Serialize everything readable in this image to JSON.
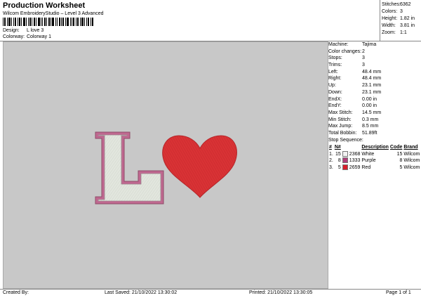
{
  "header": {
    "title": "Production Worksheet",
    "subtitle": "Wilcom EmbroideryStudio – Level 3 Advanced",
    "design_label": "Design:",
    "design_value": "L love 3",
    "colorway_label": "Colorway:",
    "colorway_value": "Colorway 1"
  },
  "stats": [
    {
      "label": "Stitches:",
      "value": "6362"
    },
    {
      "label": "Colors:",
      "value": "3"
    },
    {
      "label": "Height:",
      "value": "1.82 in"
    },
    {
      "label": "Width:",
      "value": "3.81 in"
    },
    {
      "label": "Zoom:",
      "value": "1:1"
    }
  ],
  "info": [
    {
      "label": "Machine:",
      "value": "Tajima"
    },
    {
      "label": "Color changes:",
      "value": "2"
    },
    {
      "label": "Stops:",
      "value": "3"
    },
    {
      "label": "Trims:",
      "value": "3"
    },
    {
      "label": "Left:",
      "value": "48.4 mm"
    },
    {
      "label": "Right:",
      "value": "48.4 mm"
    },
    {
      "label": "Up:",
      "value": "23.1 mm"
    },
    {
      "label": "Down:",
      "value": "23.1 mm"
    },
    {
      "label": "EndX:",
      "value": "0.00 in"
    },
    {
      "label": "EndY:",
      "value": "0.00 in"
    },
    {
      "label": "Max Stitch:",
      "value": "14.5 mm"
    },
    {
      "label": "Min Stitch:",
      "value": "0.3 mm"
    },
    {
      "label": "Max Jump:",
      "value": "8.5 mm"
    },
    {
      "label": "Total Bobbin:",
      "value": "51.89ft"
    }
  ],
  "sequence": {
    "title": "Stop Sequence:",
    "headers": [
      "#",
      "N#",
      "",
      "Description",
      "Code",
      "Brand"
    ],
    "rows": [
      {
        "idx": "1.",
        "needle": "15",
        "swatch": "#f2f2f2",
        "num": "2368",
        "desc": "White",
        "code": "15",
        "brand": "Wilcom"
      },
      {
        "idx": "2.",
        "needle": "8",
        "swatch": "#b0407a",
        "num": "1333",
        "desc": "Purple",
        "code": "8",
        "brand": "Wilcom"
      },
      {
        "idx": "3.",
        "needle": "5",
        "swatch": "#d81e2a",
        "num": "2659",
        "desc": "Red",
        "code": "5",
        "brand": "Wilcom"
      }
    ]
  },
  "footer": {
    "created_by": "Created By:",
    "last_saved": "Last Saved: 21/10/2022 13:30:02",
    "printed": "Printed: 21/10/2022 13:30:05",
    "page": "Page 1 of 1"
  },
  "colors": {
    "canvas_bg": "#c8c8c8",
    "letter_fill": "#e2e6de",
    "letter_outline": "#c06890",
    "heart_fill": "#d93235"
  }
}
